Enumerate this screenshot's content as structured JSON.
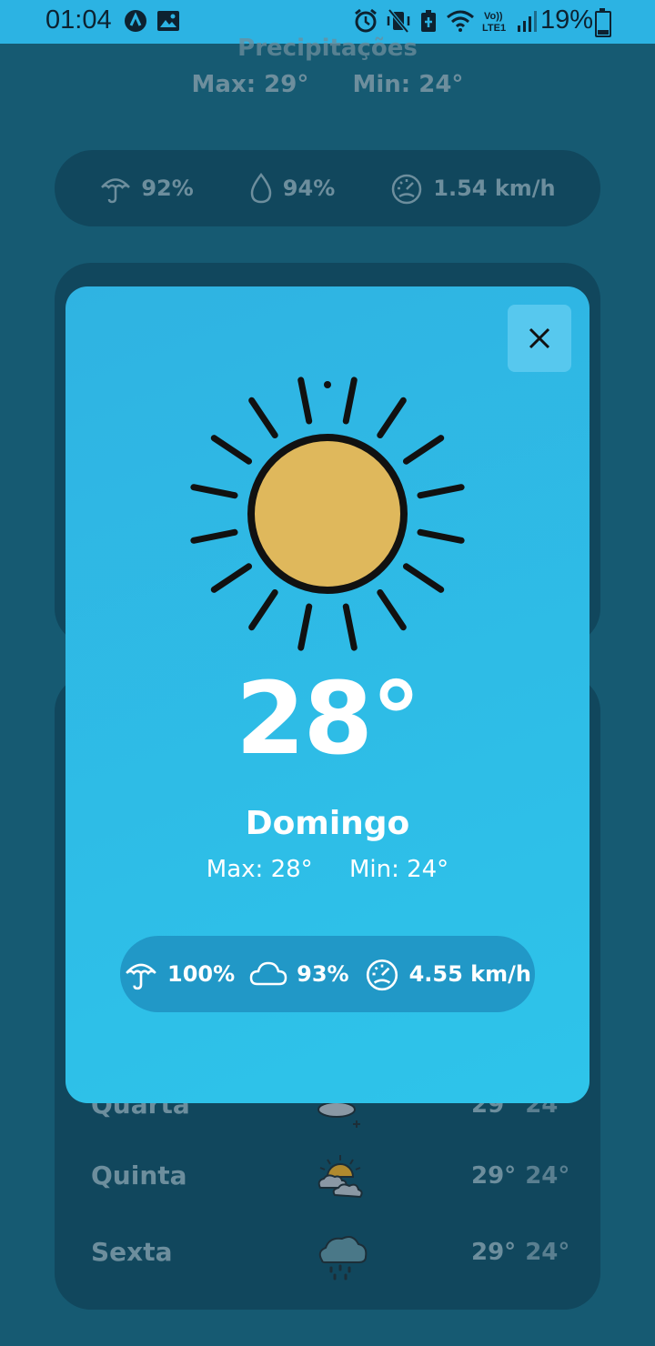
{
  "status_bar": {
    "time": "01:04",
    "battery": "19%"
  },
  "background": {
    "title": "Precipitações",
    "max": "Max: 29°",
    "min": "Min: 24°",
    "stats": {
      "rain": "92%",
      "humidity": "94%",
      "wind": "1.54 km/h"
    },
    "forecast": [
      {
        "day": "Quarta",
        "max": "29°",
        "min": "24°",
        "icon": "cloud-rain-icon"
      },
      {
        "day": "Quinta",
        "max": "29°",
        "min": "24°",
        "icon": "partly-cloudy-icon"
      },
      {
        "day": "Sexta",
        "max": "29°",
        "min": "24°",
        "icon": "rain-cloud-icon"
      }
    ]
  },
  "modal": {
    "temperature": "28°",
    "day": "Domingo",
    "max": "Max: 28°",
    "min": "Min: 24°",
    "stats": {
      "rain": "100%",
      "clouds": "93%",
      "wind": "4.55 km/h"
    }
  },
  "colors": {
    "background": "#165a72",
    "card": "#11475d",
    "modal": "#2fb3e2",
    "sun_fill": "#dfb85c"
  }
}
